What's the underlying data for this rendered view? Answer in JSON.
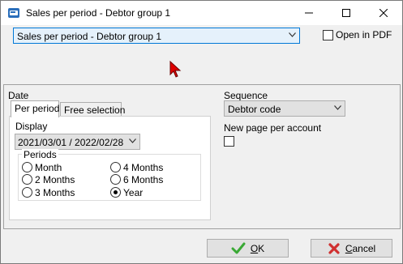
{
  "window": {
    "title": "Sales per period - Debtor group 1"
  },
  "top": {
    "report_select_value": "Sales per period - Debtor group 1",
    "open_in_pdf_label": "Open in PDF",
    "open_in_pdf_checked": false
  },
  "date": {
    "section_label": "Date",
    "tabs": [
      {
        "label": "Per period",
        "active": true
      },
      {
        "label": "Free selection",
        "active": false
      }
    ],
    "display_label": "Display",
    "display_value": "2021/03/01 / 2022/02/28",
    "periods": {
      "title": "Periods",
      "options": [
        {
          "label": "Month",
          "selected": false
        },
        {
          "label": "2 Months",
          "selected": false
        },
        {
          "label": "3 Months",
          "selected": false
        },
        {
          "label": "4 Months",
          "selected": false
        },
        {
          "label": "6 Months",
          "selected": false
        },
        {
          "label": "Year",
          "selected": true
        }
      ]
    }
  },
  "sequence": {
    "label": "Sequence",
    "value": "Debtor code",
    "new_page_label": "New page per account",
    "new_page_checked": false
  },
  "buttons": {
    "ok_first": "O",
    "ok_rest": "K",
    "cancel_first": "C",
    "cancel_rest": "ancel"
  },
  "colors": {
    "accent": "#0078d7",
    "ok_icon": "#3aa935",
    "cancel_icon": "#d03030"
  }
}
